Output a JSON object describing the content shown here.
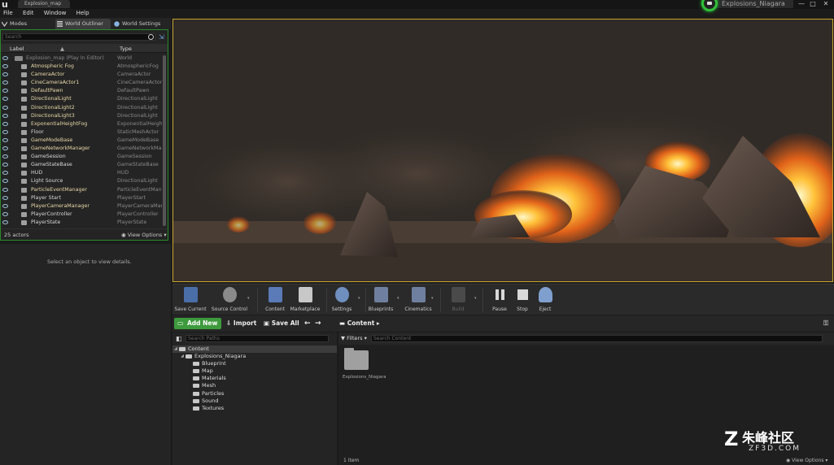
{
  "titlebar": {
    "map_tab": "Explosion_map",
    "project_name": "Explosions_Niagara",
    "minimize": "—",
    "maximize": "□",
    "close": "✕"
  },
  "menu": [
    "File",
    "Edit",
    "Window",
    "Help"
  ],
  "left_tabs": [
    {
      "label": "Modes",
      "icon": "modes-icon"
    },
    {
      "label": "World Outliner",
      "icon": "outliner-icon"
    },
    {
      "label": "World Settings",
      "icon": "globe-icon"
    }
  ],
  "outliner": {
    "search_placeholder": "Search",
    "col_label": "Label",
    "col_type": "Type",
    "root": {
      "label": "Explosion_map (Play In Editor)",
      "type": "World"
    },
    "rows": [
      {
        "label": "Atmospheric Fog",
        "type": "AtmosphericFog"
      },
      {
        "label": "CameraActor",
        "type": "CameraActor"
      },
      {
        "label": "CineCameraActor1",
        "type": "CineCameraActor"
      },
      {
        "label": "DefaultPawn",
        "type": "DefaultPawn"
      },
      {
        "label": "DirectionalLight",
        "type": "DirectionalLight"
      },
      {
        "label": "DirectionalLight2",
        "type": "DirectionalLight"
      },
      {
        "label": "DirectionalLight3",
        "type": "DirectionalLight"
      },
      {
        "label": "ExponentialHeightFog",
        "type": "ExponentialHeightFog"
      },
      {
        "label": "Floor",
        "type": "StaticMeshActor"
      },
      {
        "label": "GameModeBase",
        "type": "GameModeBase"
      },
      {
        "label": "GameNetworkManager",
        "type": "GameNetworkManager"
      },
      {
        "label": "GameSession",
        "type": "GameSession"
      },
      {
        "label": "GameStateBase",
        "type": "GameStateBase"
      },
      {
        "label": "HUD",
        "type": "HUD"
      },
      {
        "label": "Light Source",
        "type": "DirectionalLight"
      },
      {
        "label": "ParticleEventManager",
        "type": "ParticleEventManager"
      },
      {
        "label": "Player Start",
        "type": "PlayerStart"
      },
      {
        "label": "PlayerCameraManager",
        "type": "PlayerCameraManager"
      },
      {
        "label": "PlayerController",
        "type": "PlayerController"
      },
      {
        "label": "PlayerState",
        "type": "PlayerState"
      }
    ],
    "actor_count": "25 actors",
    "view_options": "View Options"
  },
  "details": {
    "empty_text": "Select an object to view details."
  },
  "toolbar": [
    {
      "label": "Save Current",
      "icon": "save-icon",
      "color": "#4a6fa8"
    },
    {
      "label": "Source Control",
      "icon": "source-control-icon",
      "color": "#d04040"
    },
    {
      "label": "Content",
      "icon": "content-icon",
      "color": "#5a7ab8"
    },
    {
      "label": "Marketplace",
      "icon": "marketplace-icon",
      "color": "#c8c8c8"
    },
    {
      "label": "Settings",
      "icon": "settings-icon",
      "color": "#6f8fbf"
    },
    {
      "label": "Blueprints",
      "icon": "blueprints-icon",
      "color": "#6f7f9f"
    },
    {
      "label": "Cinematics",
      "icon": "cinematics-icon",
      "color": "#6f7f9f"
    },
    {
      "label": "Build",
      "icon": "build-icon",
      "color": "#4a4a4a"
    },
    {
      "label": "Pause",
      "icon": "pause-icon",
      "color": "#d8d8d8"
    },
    {
      "label": "Stop",
      "icon": "stop-icon",
      "color": "#d8d8d8"
    },
    {
      "label": "Eject",
      "icon": "eject-icon",
      "color": "#7f9fcf"
    }
  ],
  "content_browser": {
    "add_new": "Add New",
    "import": "Import",
    "save_all": "Save All",
    "path_root": "Content",
    "search_paths_placeholder": "Search Paths",
    "filters": "Filters",
    "search_content_placeholder": "Search Content",
    "tree": [
      {
        "label": "Content",
        "level": 0
      },
      {
        "label": "Explosions_Niagara",
        "level": 1
      },
      {
        "label": "Blueprint",
        "level": 2
      },
      {
        "label": "Map",
        "level": 2
      },
      {
        "label": "Materials",
        "level": 2
      },
      {
        "label": "Mesh",
        "level": 2
      },
      {
        "label": "Particles",
        "level": 2
      },
      {
        "label": "Sound",
        "level": 2
      },
      {
        "label": "Textures",
        "level": 2
      }
    ],
    "folder_tile_label": "Explosions_Niagara",
    "item_count": "1 item",
    "view_options": "View Options"
  },
  "watermark": {
    "text": "朱峰社区",
    "sub": "ZF3D.COM"
  }
}
